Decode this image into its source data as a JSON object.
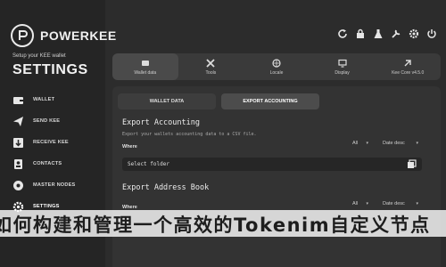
{
  "brand": {
    "name": "POWERKEE"
  },
  "header": {
    "subtitle": "Setup your KEE wallet",
    "title": "SETTINGS"
  },
  "sidebar": {
    "items": [
      {
        "label": "WALLET",
        "icon": "wallet-icon"
      },
      {
        "label": "SEND KEE",
        "icon": "send-icon"
      },
      {
        "label": "RECEIVE KEE",
        "icon": "receive-icon"
      },
      {
        "label": "CONTACTS",
        "icon": "contacts-icon"
      },
      {
        "label": "MASTER NODES",
        "icon": "master-nodes-icon"
      },
      {
        "label": "SETTINGS",
        "icon": "gear-icon",
        "active": true
      }
    ]
  },
  "top_icons": [
    "refresh-icon",
    "lock-icon",
    "flask-icon",
    "tool-icon",
    "gear-icon",
    "power-icon"
  ],
  "tabs": [
    {
      "label": "Wallet data",
      "icon": "wallet-data-icon",
      "active": true
    },
    {
      "label": "Tools",
      "icon": "tools-icon"
    },
    {
      "label": "Locale",
      "icon": "locale-icon"
    },
    {
      "label": "Display",
      "icon": "display-icon"
    },
    {
      "label": "Kee Core v4.5.0",
      "icon": "core-icon"
    }
  ],
  "subtabs": [
    {
      "label": "WALLET DATA",
      "active": false
    },
    {
      "label": "EXPORT ACCOUNTING",
      "active": true
    }
  ],
  "export_accounting": {
    "title": "Export Accounting",
    "description": "Export your wallets accounting data to a CSV file.",
    "where_label": "Where",
    "filter_value": "All",
    "sort_value": "Date desc",
    "folder_value": "Select folder"
  },
  "export_address_book": {
    "title": "Export Address Book",
    "where_label": "Where",
    "filter_value": "All",
    "sort_value": "Date desc"
  },
  "overlay": {
    "headline": "如何构建和管理一个高效的Tokenim自定义节点"
  },
  "colors": {
    "background": "#2c2c2c",
    "sidebar": "#252525",
    "panel": "#333333",
    "tabbar": "#3a3a3a",
    "input": "#262626"
  }
}
